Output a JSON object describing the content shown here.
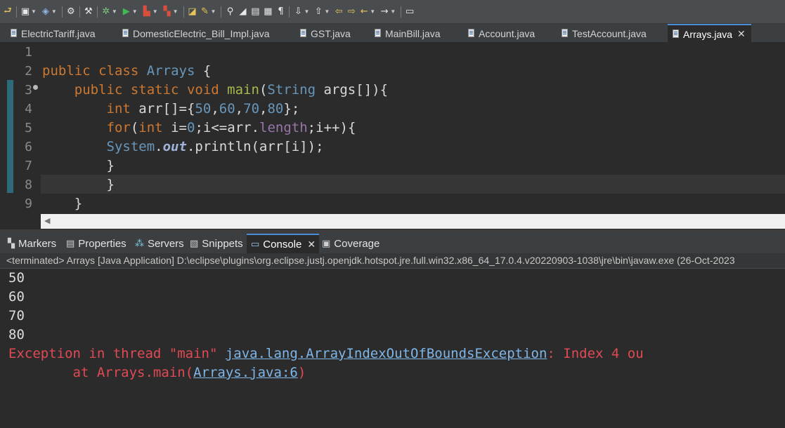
{
  "toolbar": {
    "icons": [
      "quick-access-icon",
      "new-icon",
      "save-icon",
      "print-icon",
      "build-icon",
      "debug-icon",
      "run-icon",
      "run-external-icon",
      "coverage-icon",
      "open-type-icon",
      "open-task-icon",
      "search-icon",
      "toggle-mark-icon",
      "annotations-icon",
      "show-whitespace-icon",
      "next-annotation-icon",
      "prev-annotation-icon",
      "last-edit-icon",
      "back-icon",
      "forward-icon",
      "pin-editor-icon"
    ]
  },
  "editor_tabs": [
    {
      "label": "ElectricTariff.java"
    },
    {
      "label": "DomesticElectric_Bill_Impl.java"
    },
    {
      "label": "GST.java"
    },
    {
      "label": "MainBill.java"
    },
    {
      "label": "Account.java"
    },
    {
      "label": "TestAccount.java"
    },
    {
      "label": "Arrays.java",
      "active": true,
      "close": "✕"
    }
  ],
  "editor": {
    "line_numbers": [
      "1",
      "2",
      "3",
      "4",
      "5",
      "6",
      "7",
      "8",
      "9"
    ],
    "lines": [
      "",
      "public class Arrays {",
      "    public static void main(String args[]){",
      "        int arr[]={50,60,70,80};",
      "        for(int i=0;i<=arr.length;i++){",
      "        System.out.println(arr[i]);",
      "        }",
      "        }",
      "    }"
    ]
  },
  "view_tabs": [
    {
      "label": "Markers",
      "icon": "markers-icon"
    },
    {
      "label": "Properties",
      "icon": "properties-icon"
    },
    {
      "label": "Servers",
      "icon": "servers-icon"
    },
    {
      "label": "Snippets",
      "icon": "snippets-icon"
    },
    {
      "label": "Console",
      "icon": "console-icon",
      "active": true,
      "close": "✕"
    },
    {
      "label": "Coverage",
      "icon": "coverage-icon"
    }
  ],
  "console": {
    "status": "<terminated> Arrays [Java Application] D:\\eclipse\\plugins\\org.eclipse.justj.openjdk.hotspot.jre.full.win32.x86_64_17.0.4.v20220903-1038\\jre\\bin\\javaw.exe  (26-Oct-2023",
    "output": [
      "50",
      "60",
      "70",
      "80"
    ],
    "exception_prefix": "Exception in thread \"main\" ",
    "exception_class": "java.lang.ArrayIndexOutOfBoundsException",
    "exception_suffix": ": Index 4 ou",
    "stack_prefix": "\tat Arrays.main(",
    "stack_link": "Arrays.java:6",
    "stack_suffix": ")"
  },
  "colors": {
    "keyword": "#cc7832",
    "class": "#6897bb",
    "method": "#a9b74c",
    "error": "#e04a54",
    "link": "#7fb6e8"
  }
}
